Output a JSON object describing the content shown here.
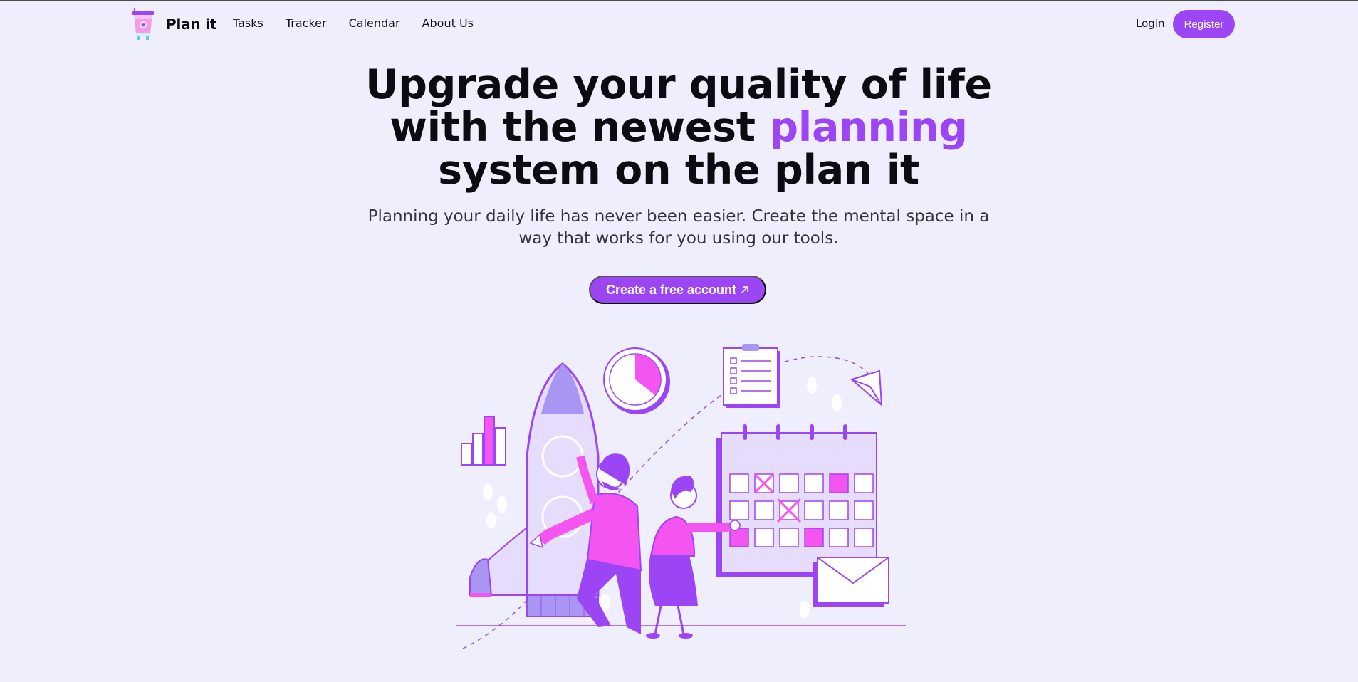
{
  "nav": {
    "brand": "Plan it",
    "links": [
      "Tasks",
      "Tracker",
      "Calendar",
      "About Us"
    ],
    "login": "Login",
    "register": "Register"
  },
  "hero": {
    "title_line1": "Upgrade your quality of life",
    "title_line2_pre": "with the newest ",
    "title_line2_accent": "planning",
    "title_line3": "system on the plan it",
    "subtitle": "Planning your daily life has never been easier. Create the mental space in a way that works for you using our tools.",
    "cta": "Create a free account"
  },
  "colors": {
    "background": "#efeefd",
    "accent": "#9b45f5",
    "pink": "#f454f0",
    "lavender": "#a996f3",
    "text": "#0b0b12"
  },
  "icons": {
    "logo": "pink-cup-logo-icon",
    "cta": "arrow-up-right-icon"
  }
}
